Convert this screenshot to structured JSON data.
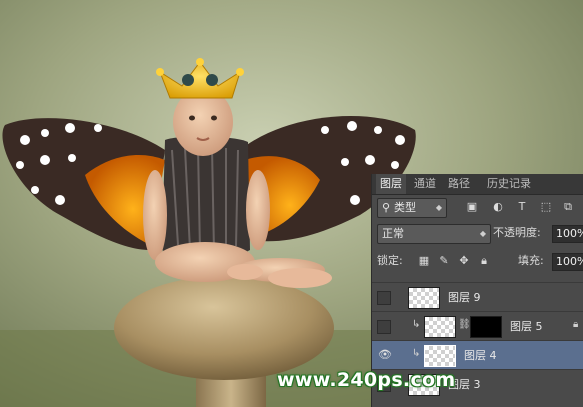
{
  "watermark": {
    "text": "www.240ps.com"
  },
  "layers_panel": {
    "tabs": [
      {
        "label": "图层",
        "active": true
      },
      {
        "label": "通道",
        "active": false
      },
      {
        "label": "路径",
        "active": false
      },
      {
        "label": "历史记录",
        "active": false
      }
    ],
    "filter": {
      "kind_label": "类型"
    },
    "blend": {
      "mode": "正常",
      "opacity_label": "不透明度:",
      "opacity_value": "100%"
    },
    "lock": {
      "label": "锁定:",
      "fill_label": "填充:",
      "fill_value": "100%"
    },
    "layers": [
      {
        "name": "图层 9",
        "visible": false,
        "active": false
      },
      {
        "name": "图层 5",
        "visible": false,
        "active": false,
        "clipped": true,
        "has_mask": true
      },
      {
        "name": "图层 4",
        "visible": true,
        "active": true,
        "clipped": true
      },
      {
        "name": "图层 3",
        "visible": false,
        "active": false
      }
    ]
  },
  "colors": {
    "panel_bg": "#4a4a4a",
    "tab_bar": "#383838",
    "selected_layer": "#5b6f8f",
    "watermark_outline": "#2a7a2a"
  },
  "icons": [
    "search-icon",
    "image-filter-icon",
    "circle-filter-icon",
    "text-filter-icon",
    "shape-filter-icon",
    "smart-object-filter-icon",
    "toggle-filter-icon",
    "lock-transparent-icon",
    "lock-paint-icon",
    "lock-move-icon",
    "lock-all-icon",
    "eye-icon",
    "clip-arrow-icon",
    "chain-icon",
    "layer-lock-icon"
  ]
}
